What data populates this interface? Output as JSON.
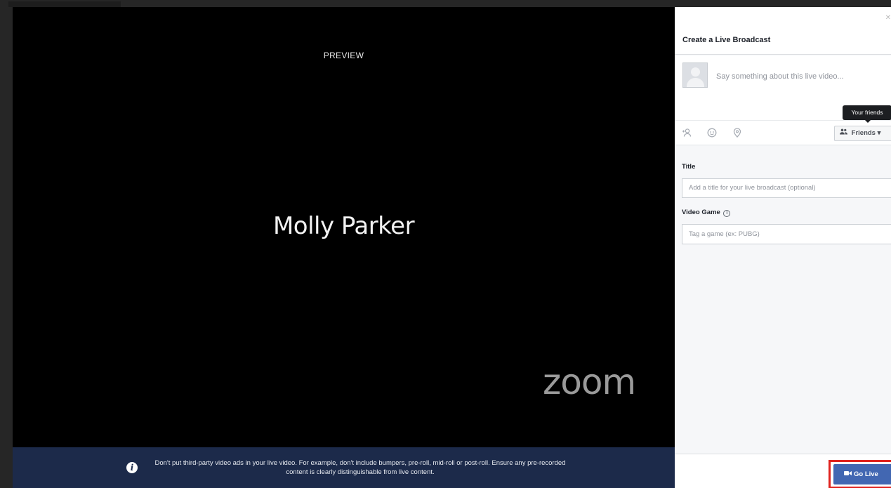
{
  "preview": {
    "label": "PREVIEW",
    "participant_name": "Molly Parker",
    "watermark": "zoom",
    "notice": {
      "icon": "info-icon",
      "text": "Don't put third-party video ads in your live video. For example, don't include bumpers, pre-roll, mid-roll or post-roll. Ensure any pre-recorded content is clearly distinguishable from live content."
    }
  },
  "panel": {
    "title": "Create a Live Broadcast",
    "close_icon": "close-icon",
    "composer": {
      "placeholder": "Say something about this live video..."
    },
    "audience": {
      "tooltip": "Your friends",
      "button_label": "Friends",
      "icon": "friends-icon"
    },
    "toolbar_icons": [
      "tag-people-icon",
      "feeling-icon",
      "location-icon"
    ],
    "title_field": {
      "label": "Title",
      "placeholder": "Add a title for your live broadcast (optional)"
    },
    "game_field": {
      "label": "Video Game",
      "placeholder": "Tag a game (ex: PUBG)"
    },
    "go_live": {
      "label": "Go Live",
      "icon": "video-camera-icon"
    }
  },
  "colors": {
    "notice_bg": "#1c2a4a",
    "go_live_bg": "#4267b2",
    "highlight": "#e0231f"
  }
}
